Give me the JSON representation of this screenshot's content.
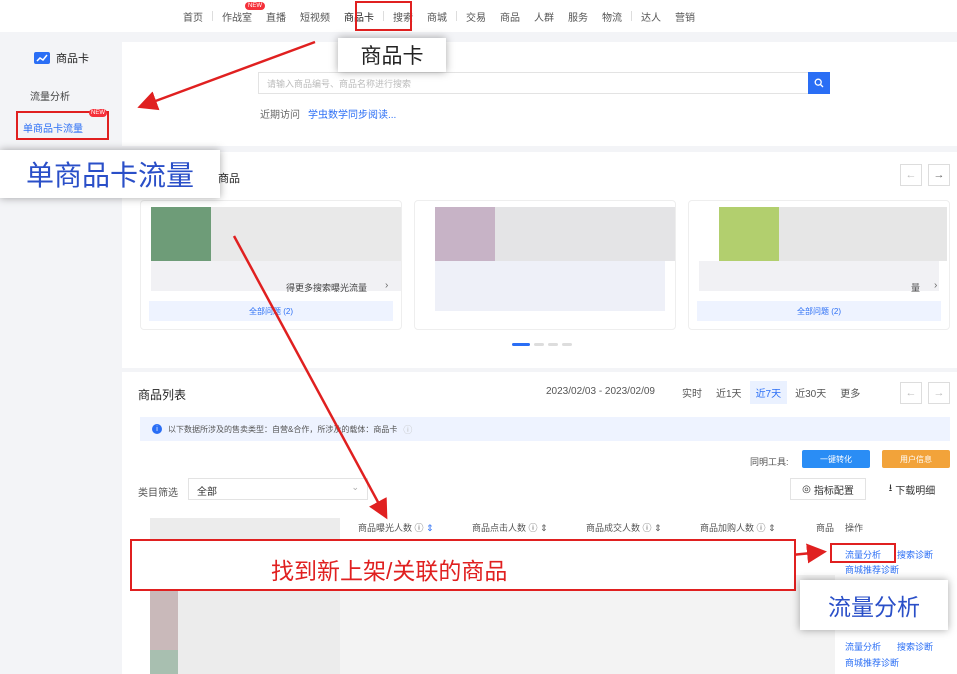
{
  "topnav": {
    "items": [
      "首页",
      "作战室",
      "直播",
      "短视频",
      "商品卡",
      "搜索",
      "商城",
      "交易",
      "商品",
      "人群",
      "服务",
      "物流",
      "达人",
      "营销"
    ],
    "new_badge": "NEW"
  },
  "sidebar": {
    "title": "商品卡",
    "items": [
      "流量分析",
      "单商品卡流量"
    ],
    "new_badge": "NEW"
  },
  "search": {
    "placeholder": "请输入商品编号、商品名称进行搜索",
    "recent_label": "近期访问",
    "recent_link": "学虫数学同步阅读..."
  },
  "cards": {
    "hint_text": "得更多搜索曝光流量",
    "hint_text_right": "量",
    "issues_btn": "全部问题 (2)",
    "issues_btn_2": "全部问题 (2)"
  },
  "list": {
    "title": "商品列表",
    "date_range": "2023/02/03 - 2023/02/09",
    "tabs": [
      "实时",
      "近1天",
      "近7天",
      "近30天",
      "更多"
    ],
    "selected_tab": "近7天",
    "notice": "以下数据所涉及的售卖类型：自营&合作，所涉及的载体：商品卡",
    "tools_label": "同明工具:",
    "tool_btn_1": "一键转化",
    "tool_btn_2": "用户信息",
    "filter_label": "类目筛选",
    "filter_value": "全部",
    "metric_config": "指标配置",
    "download": "下载明细",
    "headers": [
      "商品曝光人数",
      "商品点击人数",
      "商品成交人数",
      "商品加购人数",
      "商品",
      "操作"
    ],
    "op_traffic": "流量分析",
    "op_search": "搜索诊断",
    "op_mall": "商城推荐诊断"
  },
  "annotations": {
    "callout_top": "商品卡",
    "callout_left": "单商品卡流量",
    "callout_center": "找到新上架/关联的商品",
    "callout_right": "流量分析"
  },
  "colors": {
    "accent": "#2a6ef5",
    "highlight_red": "#e02020",
    "orange": "#f2a33a"
  }
}
